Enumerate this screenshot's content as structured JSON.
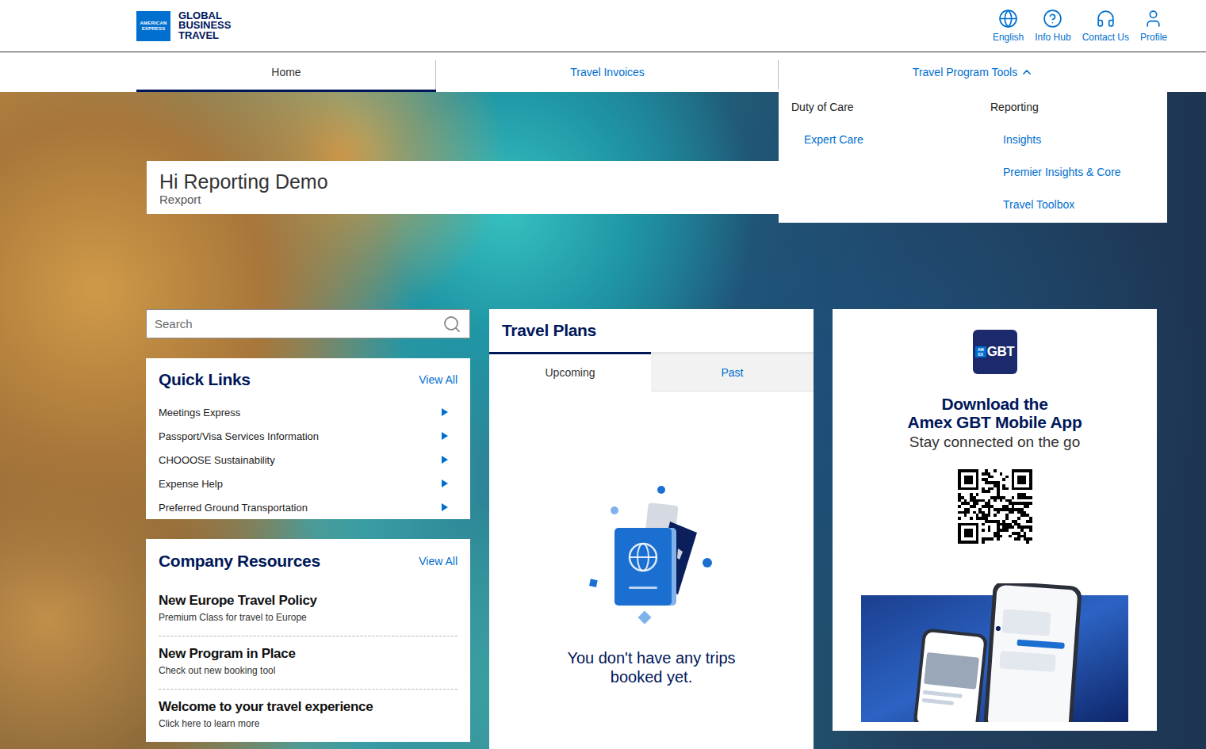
{
  "header": {
    "logo": {
      "mark": [
        "AMERICAN",
        "EXPRESS"
      ],
      "name": [
        "GLOBAL",
        "BUSINESS",
        "TRAVEL"
      ]
    },
    "utilities": [
      {
        "label": "English"
      },
      {
        "label": "Info Hub"
      },
      {
        "label": "Contact Us"
      },
      {
        "label": "Profile"
      }
    ]
  },
  "nav": {
    "tabs": [
      {
        "label": "Home",
        "selected": true,
        "kind": "link",
        "expanded": false
      },
      {
        "label": "Travel Invoices",
        "selected": false,
        "kind": "link",
        "expanded": false
      },
      {
        "label": "Travel Program Tools",
        "selected": false,
        "kind": "menu",
        "expanded": true
      }
    ]
  },
  "menu": {
    "sections": [
      {
        "title": "Duty of Care",
        "links": [
          "Expert Care"
        ]
      },
      {
        "title": "Reporting",
        "links": [
          "Insights",
          "Premier Insights & Core",
          "Travel Toolbox"
        ]
      }
    ]
  },
  "greeting": {
    "title": "Hi Reporting Demo",
    "subtitle": "Rexport"
  },
  "search": {
    "placeholder": "Search"
  },
  "quickLinks": {
    "title": "Quick Links",
    "viewAll": "View All",
    "items": [
      "Meetings Express",
      "Passport/Visa Services Information",
      "CHOOOSE Sustainability",
      "Expense Help",
      "Preferred Ground Transportation"
    ]
  },
  "companyResources": {
    "title": "Company Resources",
    "viewAll": "View All",
    "items": [
      {
        "title": "New Europe Travel Policy",
        "subtitle": "Premium Class for travel to Europe"
      },
      {
        "title": "New Program in Place",
        "subtitle": "Check out new booking tool"
      },
      {
        "title": "Welcome to your travel experience",
        "subtitle": "Click here to learn more"
      }
    ]
  },
  "travelPlans": {
    "title": "Travel Plans",
    "tabs": [
      {
        "label": "Upcoming",
        "selected": true
      },
      {
        "label": "Past",
        "selected": false
      }
    ],
    "empty": "You don't have any trips booked yet."
  },
  "app": {
    "badge": {
      "mark": [
        "AM",
        "EX"
      ],
      "label": "GBT"
    },
    "title": [
      "Download the",
      "Amex GBT Mobile App"
    ],
    "subtitle": "Stay connected on the go"
  }
}
